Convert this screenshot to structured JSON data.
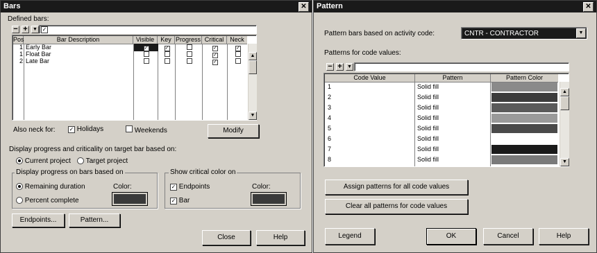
{
  "bars_dialog": {
    "title": "Bars",
    "defined_bars_label": "Defined bars:",
    "columns": [
      "Pos",
      "Bar Description",
      "Visible",
      "Key",
      "Progress",
      "Critical",
      "Neck"
    ],
    "rows": [
      {
        "pos": "1",
        "desc": "Early Bar",
        "visible": true,
        "key": true,
        "progress": false,
        "critical": true,
        "neck": true
      },
      {
        "pos": "1",
        "desc": "Float Bar",
        "visible": false,
        "key": false,
        "progress": false,
        "critical": true,
        "neck": false
      },
      {
        "pos": "2",
        "desc": "Late Bar",
        "visible": false,
        "key": false,
        "progress": false,
        "critical": true,
        "neck": false
      }
    ],
    "also_neck_for_label": "Also neck for:",
    "holidays_label": "Holidays",
    "holidays_checked": true,
    "weekends_label": "Weekends",
    "weekends_checked": false,
    "modify_label": "Modify",
    "display_target_label": "Display progress and criticality on target bar based on:",
    "current_project_label": "Current project",
    "target_project_label": "Target project",
    "target_selected": "current",
    "display_progress_group_label": "Display progress on bars based on",
    "remaining_duration_label": "Remaining duration",
    "percent_complete_label": "Percent complete",
    "progress_selected": "remaining",
    "color_label": "Color:",
    "progress_color": "#3a3a3a",
    "show_critical_group_label": "Show critical color on",
    "endpoints_label": "Endpoints",
    "endpoints_checked": true,
    "bar_label": "Bar",
    "bar_checked": true,
    "critical_color": "#3a3a3a",
    "endpoints_button": "Endpoints...",
    "pattern_button": "Pattern...",
    "close_button": "Close",
    "help_button": "Help"
  },
  "pattern_dialog": {
    "title": "Pattern",
    "pattern_bars_label": "Pattern bars based on activity code:",
    "activity_code_value": "CNTR - CONTRACTOR",
    "patterns_for_label": "Patterns for code values:",
    "columns": [
      "Code Value",
      "Pattern",
      "Pattern Color"
    ],
    "rows": [
      {
        "code": "1",
        "pattern": "Solid fill",
        "color": "#8a8a8a"
      },
      {
        "code": "2",
        "pattern": "Solid fill",
        "color": "#3c3c3c"
      },
      {
        "code": "3",
        "pattern": "Solid fill",
        "color": "#5a5a5a"
      },
      {
        "code": "4",
        "pattern": "Solid fill",
        "color": "#9a9a9a"
      },
      {
        "code": "5",
        "pattern": "Solid fill",
        "color": "#4a4a4a"
      },
      {
        "code": "6",
        "pattern": "Solid fill",
        "color": "#ffffff"
      },
      {
        "code": "7",
        "pattern": "Solid fill",
        "color": "#1a1a1a"
      },
      {
        "code": "8",
        "pattern": "Solid fill",
        "color": "#7a7a7a"
      }
    ],
    "assign_button": "Assign patterns for all code values",
    "clear_button": "Clear all patterns for code values",
    "legend_button": "Legend",
    "ok_button": "OK",
    "cancel_button": "Cancel",
    "help_button": "Help"
  }
}
